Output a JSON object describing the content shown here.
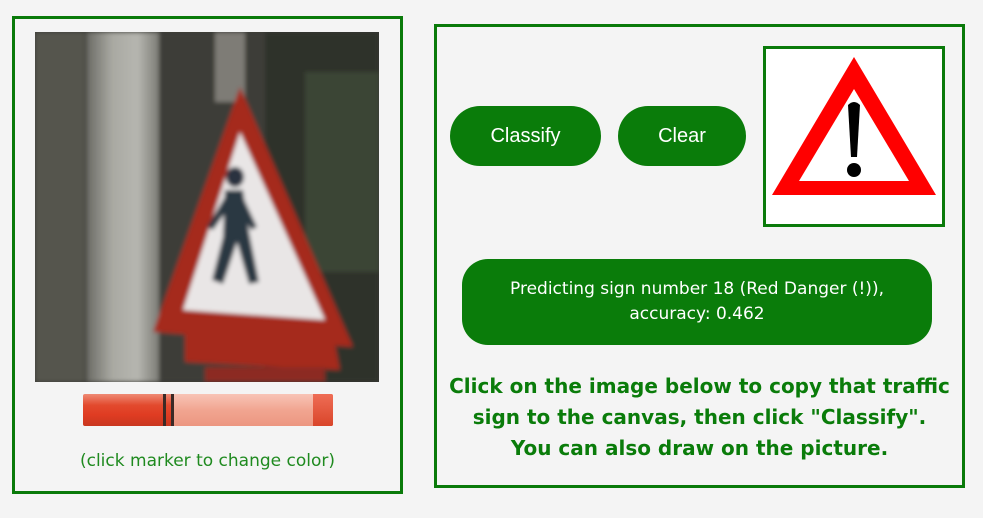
{
  "left": {
    "canvas_alt": "traffic sign drawing canvas",
    "marker_colors": {
      "light": "#f1a591",
      "dark": "#e03c22"
    },
    "hint": "(click marker to change color)"
  },
  "right": {
    "buttons": {
      "classify": "Classify",
      "clear": "Clear"
    },
    "sample_sign_icon": "warning-triangle-exclamation-icon",
    "prediction": {
      "line1": "Predicting sign number 18 (Red Danger (!)),",
      "line2": "accuracy: 0.462"
    },
    "instructions": {
      "line1": "Click on the image below to copy that traffic",
      "line2": "sign to the canvas, then click \"Classify\".",
      "line3": "You can also draw on the picture."
    }
  },
  "colors": {
    "accent": "#0a7c0a",
    "background": "#f4f4f4"
  }
}
